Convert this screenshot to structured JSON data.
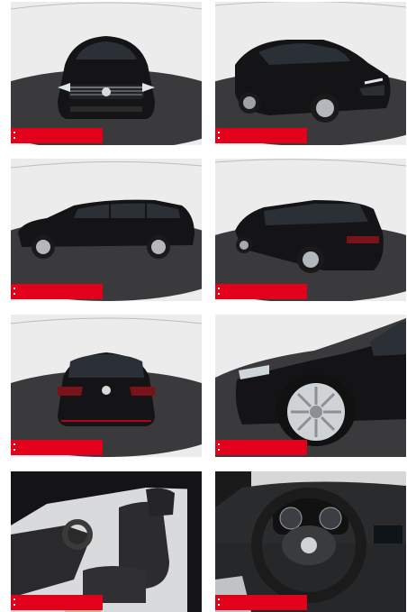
{
  "gallery": {
    "tiles": [
      {
        "view": "front",
        "badge_text": ""
      },
      {
        "view": "front-left-three-quarter",
        "badge_text": ""
      },
      {
        "view": "side-left",
        "badge_text": ""
      },
      {
        "view": "rear-left-three-quarter",
        "badge_text": ""
      },
      {
        "view": "rear",
        "badge_text": ""
      },
      {
        "view": "front-wheel-detail",
        "badge_text": ""
      },
      {
        "view": "interior-front-seats",
        "badge_text": ""
      },
      {
        "view": "interior-dashboard",
        "badge_text": ""
      }
    ],
    "colors": {
      "badge": "#e3001b",
      "car_body": "#141416",
      "turntable": "#3a3a3c",
      "backdrop": "#e9e9e9"
    }
  }
}
